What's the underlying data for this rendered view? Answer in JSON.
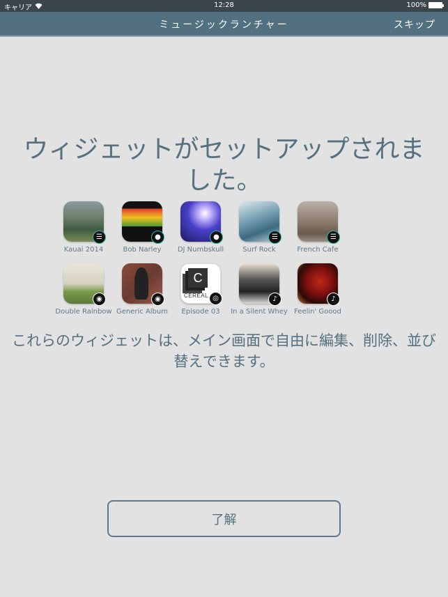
{
  "status_bar": {
    "carrier": "キャリア",
    "wifi_icon": "wifi-icon",
    "time": "12:28",
    "battery": "100%",
    "battery_icon": "battery-icon"
  },
  "nav_bar": {
    "title": "ミュージックランチャー",
    "skip_label": "スキップ"
  },
  "headline": "ウィジェットがセットアップされました。",
  "widgets": [
    {
      "label": "Kauai 2014",
      "style": "kauai",
      "badge": "playlist-icon",
      "badge_glyph": "☰"
    },
    {
      "label": "Bob Narley",
      "style": "bob",
      "badge": "artist-icon",
      "badge_glyph": "●"
    },
    {
      "label": "DJ Numbskull",
      "style": "dj",
      "badge": "artist-icon",
      "badge_glyph": "●"
    },
    {
      "label": "Surf Rock",
      "style": "surf",
      "badge": "playlist-icon",
      "badge_glyph": "☰"
    },
    {
      "label": "French Cafe",
      "style": "french",
      "badge": "playlist-icon",
      "badge_glyph": "☰"
    },
    {
      "label": "Double Rainbow",
      "style": "rainbow",
      "badge": "album-icon",
      "badge_glyph": "◉"
    },
    {
      "label": "Generic Album",
      "style": "generic",
      "badge": "album-icon",
      "badge_glyph": "◉"
    },
    {
      "label": "Episode 03",
      "style": "cereal",
      "badge": "podcast-icon",
      "badge_glyph": "◎",
      "art_letter": "C",
      "art_text": "CEREAL"
    },
    {
      "label": "In a Silent Whey",
      "style": "silent",
      "badge": "song-icon",
      "badge_glyph": "♪"
    },
    {
      "label": "Feelin' Goood",
      "style": "feelin",
      "badge": "song-icon",
      "badge_glyph": "♪"
    }
  ],
  "subtext": "これらのウィジェットは、メイン画面で自由に編集、削除、並び替えできます。",
  "ok_button_label": "了解"
}
